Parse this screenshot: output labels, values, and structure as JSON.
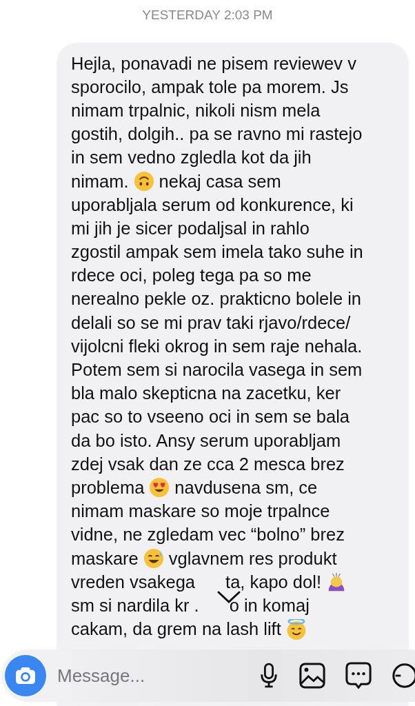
{
  "timestamp": "YESTERDAY 2:03 PM",
  "message": {
    "lines": [
      {
        "segments": [
          {
            "kind": "text",
            "text": "Hejla, ponavadi ne pisem reviewev v"
          }
        ]
      },
      {
        "segments": [
          {
            "kind": "text",
            "text": "sporocilo, ampak tole pa morem. Js"
          }
        ]
      },
      {
        "segments": [
          {
            "kind": "text",
            "text": "nimam trpalnic, nikoli nism mela"
          }
        ]
      },
      {
        "segments": [
          {
            "kind": "text",
            "text": "gostih, dolgih.. pa se ravno mi rastejo"
          }
        ]
      },
      {
        "segments": [
          {
            "kind": "text",
            "text": "in sem vedno zgledla kot da jih"
          }
        ]
      },
      {
        "segments": [
          {
            "kind": "text",
            "text": "nimam."
          },
          {
            "kind": "upside-down-emoji"
          },
          {
            "kind": "text",
            "text": "nekaj casa sem"
          }
        ]
      },
      {
        "segments": [
          {
            "kind": "text",
            "text": "uporabljala serum od konkurence, ki"
          }
        ]
      },
      {
        "segments": [
          {
            "kind": "text",
            "text": "mi jih je sicer podaljsal in rahlo"
          }
        ]
      },
      {
        "segments": [
          {
            "kind": "text",
            "text": "zgostil ampak sem imela tako suhe in"
          }
        ]
      },
      {
        "segments": [
          {
            "kind": "text",
            "text": "rdece oci, poleg tega pa so me"
          }
        ]
      },
      {
        "segments": [
          {
            "kind": "text",
            "text": "nerealno pekle oz. prakticno bolele in"
          }
        ]
      },
      {
        "segments": [
          {
            "kind": "text",
            "text": "delali so se mi prav taki rjavo/rdece/"
          }
        ]
      },
      {
        "segments": [
          {
            "kind": "text",
            "text": "vijolcni fleki okrog in sem raje nehala."
          }
        ]
      },
      {
        "segments": [
          {
            "kind": "text",
            "text": "Potem sem si narocila vasega in sem"
          }
        ]
      },
      {
        "segments": [
          {
            "kind": "text",
            "text": "bla malo skepticna na zacetku, ker"
          }
        ]
      },
      {
        "segments": [
          {
            "kind": "text",
            "text": "pac so to vseeno oci in sem se bala"
          }
        ]
      },
      {
        "segments": [
          {
            "kind": "text",
            "text": "da bo isto. Ansy serum uporabljam"
          }
        ]
      },
      {
        "segments": [
          {
            "kind": "text",
            "text": "zdej vsak dan ze cca 2 mesca brez"
          }
        ]
      },
      {
        "segments": [
          {
            "kind": "text",
            "text": "problema"
          },
          {
            "kind": "heart-eyes-emoji"
          },
          {
            "kind": "text",
            "text": "navdusena sm, ce"
          }
        ]
      },
      {
        "segments": [
          {
            "kind": "text",
            "text": "nimam maskare so moje trpalnce"
          }
        ]
      },
      {
        "segments": [
          {
            "kind": "text",
            "text": "vidne, ne zgledam vec “bolno” brez"
          }
        ]
      },
      {
        "segments": [
          {
            "kind": "text",
            "text": "maskare"
          },
          {
            "kind": "sweat-smile-emoji"
          },
          {
            "kind": "text",
            "text": "vglavnem res produkt"
          }
        ]
      },
      {
        "segments": [
          {
            "kind": "text",
            "text": "vreden vsakega"
          },
          {
            "kind": "covered"
          },
          {
            "kind": "text",
            "text": "ta, kapo dol!"
          },
          {
            "kind": "bowing-emoji"
          }
        ]
      },
      {
        "segments": [
          {
            "kind": "text",
            "text": "sm si nardila kr ."
          },
          {
            "kind": "covered"
          },
          {
            "kind": "text",
            "text": "o in komaj"
          }
        ]
      },
      {
        "segments": [
          {
            "kind": "text",
            "text": "cakam, da grem na lash lift"
          },
          {
            "kind": "halo-emoji"
          }
        ]
      }
    ]
  },
  "composer": {
    "placeholder": "Message..."
  }
}
